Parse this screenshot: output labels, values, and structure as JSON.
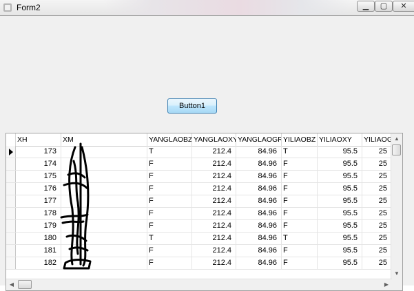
{
  "window": {
    "title": "Form2",
    "icon": "app-icon"
  },
  "window_controls": {
    "minimize": "minimize-icon",
    "maximize": "maximize-icon",
    "close": "close-icon"
  },
  "button1": {
    "label": "Button1"
  },
  "grid": {
    "columns": [
      "XH",
      "XM",
      "YANGLAOBZ",
      "YANGLAOXY",
      "YANGLAOGR",
      "YILIAOBZ",
      "YILIAOXY",
      "YILIAOG"
    ],
    "rows": [
      [
        "173",
        "",
        "T",
        "212.4",
        "84.96",
        "T",
        "95.5",
        "25"
      ],
      [
        "174",
        "",
        "F",
        "212.4",
        "84.96",
        "F",
        "95.5",
        "25"
      ],
      [
        "175",
        "",
        "F",
        "212.4",
        "84.96",
        "F",
        "95.5",
        "25"
      ],
      [
        "176",
        "",
        "F",
        "212.4",
        "84.96",
        "F",
        "95.5",
        "25"
      ],
      [
        "177",
        "",
        "F",
        "212.4",
        "84.96",
        "F",
        "95.5",
        "25"
      ],
      [
        "178",
        "",
        "F",
        "212.4",
        "84.96",
        "F",
        "95.5",
        "25"
      ],
      [
        "179",
        "",
        "F",
        "212.4",
        "84.96",
        "F",
        "95.5",
        "25"
      ],
      [
        "180",
        "",
        "T",
        "212.4",
        "84.96",
        "T",
        "95.5",
        "25"
      ],
      [
        "181",
        "",
        "F",
        "212.4",
        "84.96",
        "F",
        "95.5",
        "25"
      ],
      [
        "182",
        "",
        "F",
        "212.4",
        "84.96",
        "F",
        "95.5",
        "25"
      ]
    ],
    "current_row": 0
  },
  "colors": {
    "button_border": "#3c7fb1",
    "redaction": "#000000"
  }
}
